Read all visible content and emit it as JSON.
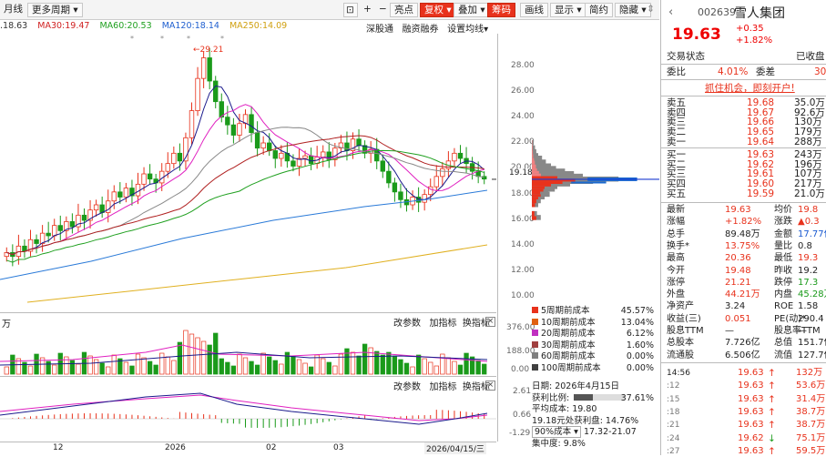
{
  "toolbar": {
    "period": "月线",
    "more": "更多周期",
    "tools": [
      "亮点",
      "复权",
      "叠加",
      "筹码",
      "画线",
      "显示",
      "简约",
      "隐藏"
    ],
    "active_tools": [
      "复权",
      "筹码"
    ]
  },
  "ma": {
    "ma20": ".18.63",
    "ma30": "MA30:19.47",
    "ma60": "MA60:20.53",
    "ma120": "MA120:18.14",
    "ma250": "MA250:14.09"
  },
  "chart": {
    "links": [
      "深股通",
      "融资融券",
      "设置均线"
    ],
    "peak_label": "29.21",
    "yticks": [
      "28.00",
      "26.00",
      "24.00",
      "22.00",
      "20.00",
      "19.18",
      "18.00",
      "16.00",
      "14.00",
      "12.00",
      "10.00"
    ],
    "xticks": [
      "12",
      "2026",
      "02",
      "03",
      "2026/04/15/三"
    ],
    "cur_price": "19.18"
  },
  "vol": {
    "unit": "万",
    "links": [
      "改参数",
      "加指标",
      "换指标"
    ],
    "yticks": [
      "376.00",
      "188.00",
      "0.00"
    ],
    "macd_yticks": [
      "2.61",
      "0.66",
      "-1.29"
    ]
  },
  "legend": [
    {
      "label": "5周期前成本",
      "pct": "45.57%",
      "color": "#e8321c"
    },
    {
      "label": "10周期前成本",
      "pct": "13.04%",
      "color": "#e06010"
    },
    {
      "label": "20周期前成本",
      "pct": "6.12%",
      "color": "#c030c0"
    },
    {
      "label": "30周期前成本",
      "pct": "1.60%",
      "color": "#a04040"
    },
    {
      "label": "60周期前成本",
      "pct": "0.00%",
      "color": "#808080"
    },
    {
      "label": "100周期前成本",
      "pct": "0.00%",
      "color": "#404040"
    }
  ],
  "info": {
    "date": "日期: 2026年4月15日",
    "profit_label": "获利比例:",
    "profit": "37.61%",
    "avg_cost": "平均成本: 19.80",
    "profit_ratio": "19.18元处获利盘: 14.76%",
    "cost_sel": "90%成本",
    "cost_range": "17.32-21.07",
    "concentration": "集中度: 9.8%"
  },
  "quote": {
    "code": "002639",
    "name": "雪人集团",
    "price": "19.63",
    "chg": "+0.35",
    "chg_pct": "+1.82%",
    "status_label": "交易状态",
    "status_val": "已收盘",
    "weibi_label": "委比",
    "weibi": "4.01%",
    "weicha_label": "委差",
    "weicha": "30",
    "promo": "抓住机会，即刻开户!",
    "sell": [
      {
        "l": "卖五",
        "p": "19.68",
        "v": "35.0万"
      },
      {
        "l": "卖四",
        "p": "19.67",
        "v": "92.6万"
      },
      {
        "l": "卖三",
        "p": "19.66",
        "v": "130万"
      },
      {
        "l": "卖二",
        "p": "19.65",
        "v": "179万"
      },
      {
        "l": "卖一",
        "p": "19.64",
        "v": "288万"
      }
    ],
    "buy": [
      {
        "l": "买一",
        "p": "19.63",
        "v": "243万"
      },
      {
        "l": "买二",
        "p": "19.62",
        "v": "196万"
      },
      {
        "l": "买三",
        "p": "19.61",
        "v": "107万"
      },
      {
        "l": "买四",
        "p": "19.60",
        "v": "217万"
      },
      {
        "l": "买五",
        "p": "19.59",
        "v": "21.0万"
      }
    ],
    "stats": [
      {
        "a": "最新",
        "b": "19.63",
        "c": "均价",
        "d": "19.8"
      },
      {
        "a": "涨幅",
        "b": "+1.82%",
        "c": "涨跌",
        "d": "▲0.3"
      },
      {
        "a": "总手",
        "b": "89.48万",
        "c": "金额",
        "d": "17.77亿"
      },
      {
        "a": "换手*",
        "b": "13.75%",
        "c": "量比",
        "d": "0.8"
      },
      {
        "a": "最高",
        "b": "20.36",
        "c": "最低",
        "d": "19.3"
      },
      {
        "a": "今开",
        "b": "19.48",
        "c": "昨收",
        "d": "19.2"
      },
      {
        "a": "涨停",
        "b": "21.21",
        "c": "跌停",
        "d": "17.3"
      },
      {
        "a": "外盘",
        "b": "44.21万",
        "c": "内盘",
        "d": "45.28万"
      },
      {
        "a": "净资产",
        "b": "3.24",
        "c": "ROE",
        "d": "1.58"
      },
      {
        "a": "收益(三)",
        "b": "0.051",
        "c": "PE(动)*",
        "d": "290.4"
      },
      {
        "a": "股息TTM",
        "b": "—",
        "c": "股息率TTM",
        "d": "—"
      },
      {
        "a": "总股本",
        "b": "7.726亿",
        "c": "总值",
        "d": "151.7亿"
      },
      {
        "a": "流通股",
        "b": "6.506亿",
        "c": "流值",
        "d": "127.7亿"
      }
    ],
    "ticks": [
      {
        "t": "14:56",
        "p": "19.63",
        "v": "132万"
      },
      {
        "t": ":12",
        "p": "19.63",
        "v": "53.6万"
      },
      {
        "t": ":15",
        "p": "19.63",
        "v": "31.4万"
      },
      {
        "t": ":18",
        "p": "19.63",
        "v": "38.7万"
      },
      {
        "t": ":21",
        "p": "19.63",
        "v": "38.7万"
      },
      {
        "t": ":24",
        "p": "19.62",
        "v": "75.1万"
      },
      {
        "t": ":27",
        "p": "19.63",
        "v": "59.5万"
      }
    ]
  }
}
